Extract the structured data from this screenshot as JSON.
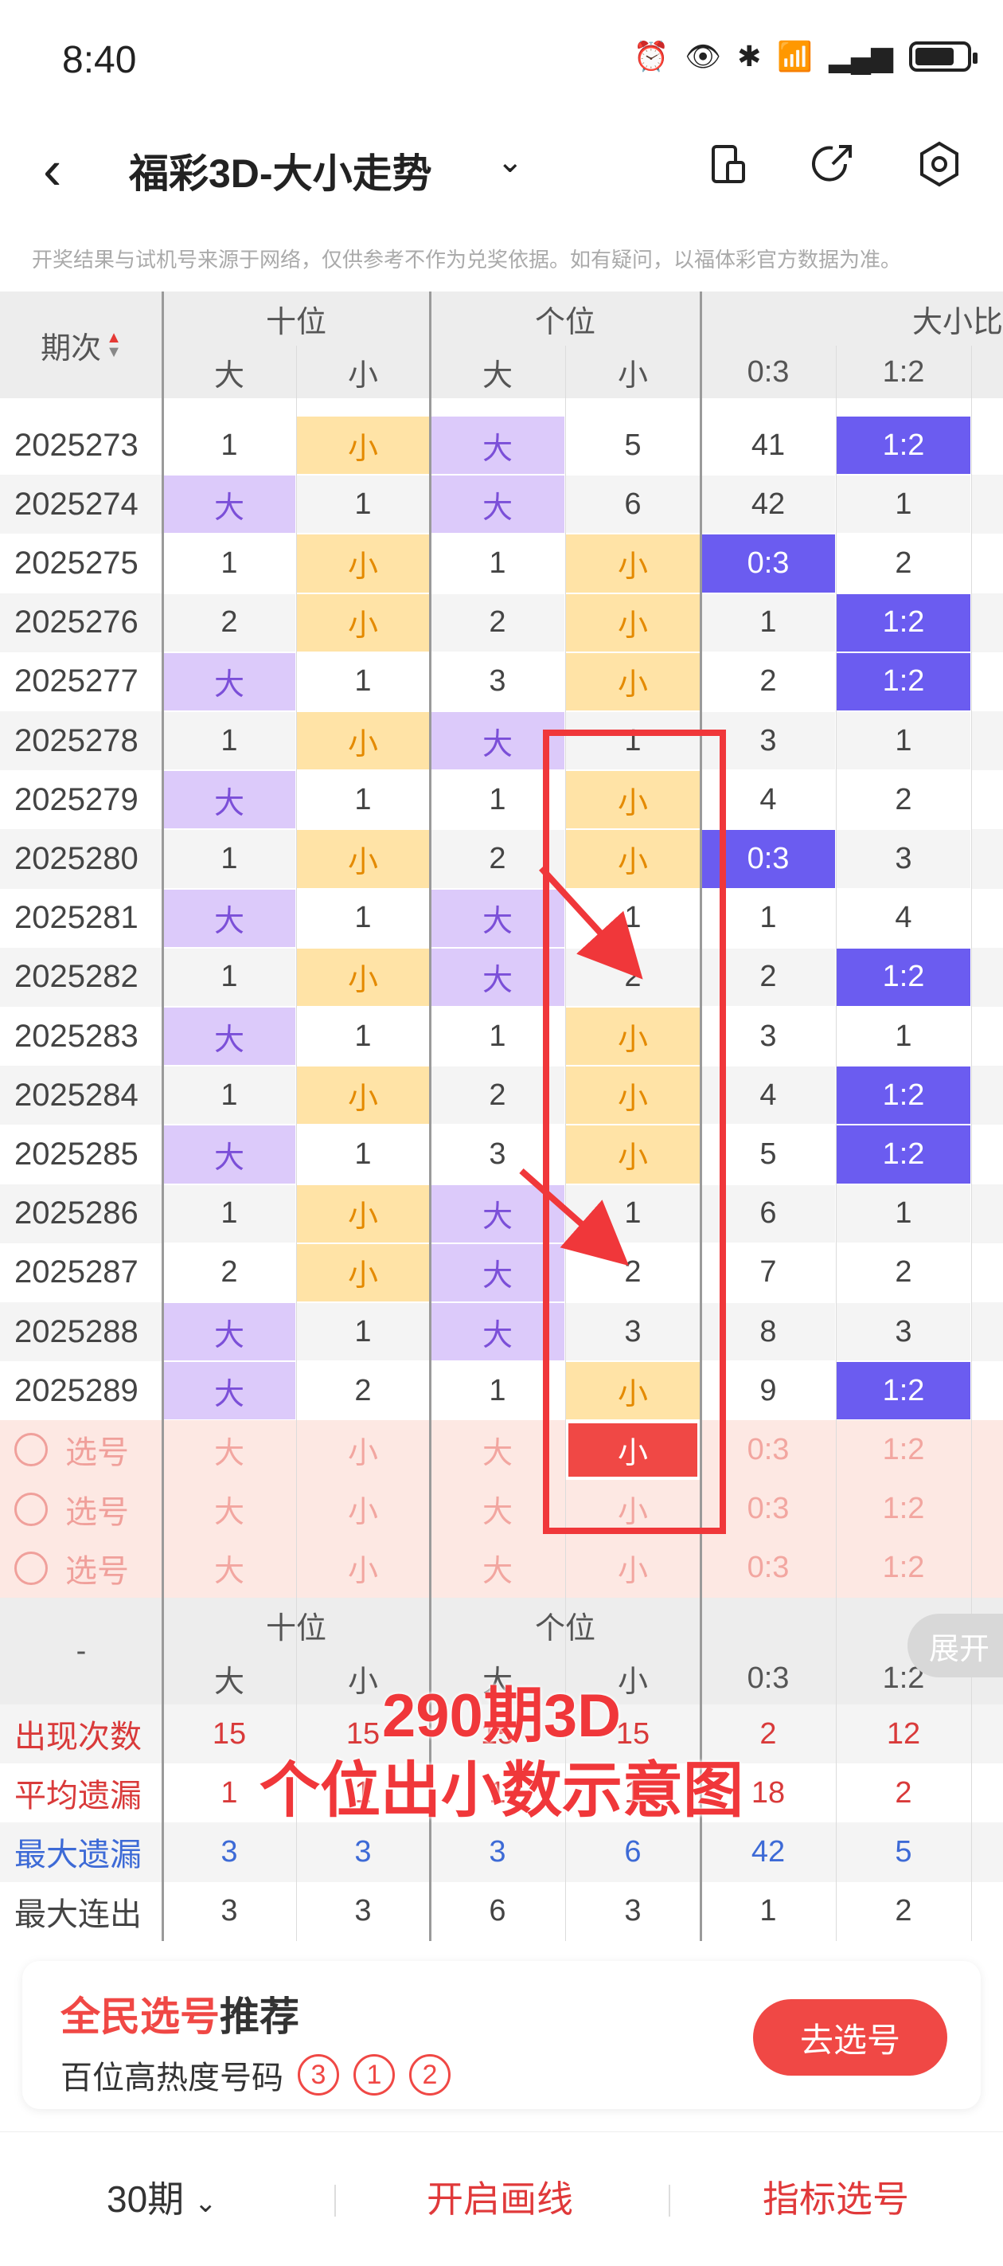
{
  "status_bar": {
    "time": "8:40"
  },
  "header": {
    "title": "福彩3D-大小走势"
  },
  "disclaimer": "开奖结果与试机号来源于网络，仅供参考不作为兑奖依据。如有疑问，以福体彩官方数据为准。",
  "table": {
    "period_header": "期次",
    "groups": [
      "十位",
      "个位",
      "大小比"
    ],
    "subheaders": [
      "大",
      "小",
      "大",
      "小",
      "0:3",
      "1:2"
    ],
    "rows": [
      {
        "p": "2025273",
        "c": [
          [
            "1",
            ""
          ],
          [
            "小",
            "s"
          ],
          [
            "大",
            "b"
          ],
          [
            "5",
            ""
          ],
          [
            "41",
            ""
          ],
          [
            "1:2",
            "r"
          ]
        ]
      },
      {
        "p": "2025274",
        "c": [
          [
            "大",
            "b"
          ],
          [
            "1",
            ""
          ],
          [
            "大",
            "b"
          ],
          [
            "6",
            ""
          ],
          [
            "42",
            ""
          ],
          [
            "1",
            ""
          ]
        ]
      },
      {
        "p": "2025275",
        "c": [
          [
            "1",
            ""
          ],
          [
            "小",
            "s"
          ],
          [
            "1",
            ""
          ],
          [
            "小",
            "s"
          ],
          [
            "0:3",
            "r"
          ],
          [
            "2",
            ""
          ]
        ]
      },
      {
        "p": "2025276",
        "c": [
          [
            "2",
            ""
          ],
          [
            "小",
            "s"
          ],
          [
            "2",
            ""
          ],
          [
            "小",
            "s"
          ],
          [
            "1",
            ""
          ],
          [
            "1:2",
            "r"
          ]
        ]
      },
      {
        "p": "2025277",
        "c": [
          [
            "大",
            "b"
          ],
          [
            "1",
            ""
          ],
          [
            "3",
            ""
          ],
          [
            "小",
            "s"
          ],
          [
            "2",
            ""
          ],
          [
            "1:2",
            "r"
          ]
        ]
      },
      {
        "p": "2025278",
        "c": [
          [
            "1",
            ""
          ],
          [
            "小",
            "s"
          ],
          [
            "大",
            "b"
          ],
          [
            "1",
            ""
          ],
          [
            "3",
            ""
          ],
          [
            "1",
            ""
          ]
        ]
      },
      {
        "p": "2025279",
        "c": [
          [
            "大",
            "b"
          ],
          [
            "1",
            ""
          ],
          [
            "1",
            ""
          ],
          [
            "小",
            "s"
          ],
          [
            "4",
            ""
          ],
          [
            "2",
            ""
          ]
        ]
      },
      {
        "p": "2025280",
        "c": [
          [
            "1",
            ""
          ],
          [
            "小",
            "s"
          ],
          [
            "2",
            ""
          ],
          [
            "小",
            "s"
          ],
          [
            "0:3",
            "r"
          ],
          [
            "3",
            ""
          ]
        ]
      },
      {
        "p": "2025281",
        "c": [
          [
            "大",
            "b"
          ],
          [
            "1",
            ""
          ],
          [
            "大",
            "b"
          ],
          [
            "1",
            ""
          ],
          [
            "1",
            ""
          ],
          [
            "4",
            ""
          ]
        ]
      },
      {
        "p": "2025282",
        "c": [
          [
            "1",
            ""
          ],
          [
            "小",
            "s"
          ],
          [
            "大",
            "b"
          ],
          [
            "2",
            ""
          ],
          [
            "2",
            ""
          ],
          [
            "1:2",
            "r"
          ]
        ]
      },
      {
        "p": "2025283",
        "c": [
          [
            "大",
            "b"
          ],
          [
            "1",
            ""
          ],
          [
            "1",
            ""
          ],
          [
            "小",
            "s"
          ],
          [
            "3",
            ""
          ],
          [
            "1",
            ""
          ]
        ]
      },
      {
        "p": "2025284",
        "c": [
          [
            "1",
            ""
          ],
          [
            "小",
            "s"
          ],
          [
            "2",
            ""
          ],
          [
            "小",
            "s"
          ],
          [
            "4",
            ""
          ],
          [
            "1:2",
            "r"
          ]
        ]
      },
      {
        "p": "2025285",
        "c": [
          [
            "大",
            "b"
          ],
          [
            "1",
            ""
          ],
          [
            "3",
            ""
          ],
          [
            "小",
            "s"
          ],
          [
            "5",
            ""
          ],
          [
            "1:2",
            "r"
          ]
        ]
      },
      {
        "p": "2025286",
        "c": [
          [
            "1",
            ""
          ],
          [
            "小",
            "s"
          ],
          [
            "大",
            "b"
          ],
          [
            "1",
            ""
          ],
          [
            "6",
            ""
          ],
          [
            "1",
            ""
          ]
        ]
      },
      {
        "p": "2025287",
        "c": [
          [
            "2",
            ""
          ],
          [
            "小",
            "s"
          ],
          [
            "大",
            "b"
          ],
          [
            "2",
            ""
          ],
          [
            "7",
            ""
          ],
          [
            "2",
            ""
          ]
        ]
      },
      {
        "p": "2025288",
        "c": [
          [
            "大",
            "b"
          ],
          [
            "1",
            ""
          ],
          [
            "大",
            "b"
          ],
          [
            "3",
            ""
          ],
          [
            "8",
            ""
          ],
          [
            "3",
            ""
          ]
        ]
      },
      {
        "p": "2025289",
        "c": [
          [
            "大",
            "b"
          ],
          [
            "2",
            ""
          ],
          [
            "1",
            ""
          ],
          [
            "小",
            "s"
          ],
          [
            "9",
            ""
          ],
          [
            "1:2",
            "r"
          ]
        ]
      }
    ],
    "select_rows": [
      {
        "label": "选号",
        "c": [
          "大",
          "小",
          "大",
          "小",
          "0:3",
          "1:2"
        ],
        "selected_col": 3
      },
      {
        "label": "选号",
        "c": [
          "大",
          "小",
          "大",
          "小",
          "0:3",
          "1:2"
        ],
        "selected_col": -1
      },
      {
        "label": "选号",
        "c": [
          "大",
          "小",
          "大",
          "小",
          "0:3",
          "1:2"
        ],
        "selected_col": -1
      }
    ],
    "stats_header_dash": "-",
    "stats": [
      {
        "label": "出现次数",
        "color": "#d93a3a",
        "c": [
          "15",
          "15",
          "15",
          "15",
          "2",
          "12"
        ]
      },
      {
        "label": "平均遗漏",
        "color": "#d93a3a",
        "c": [
          "1",
          "1",
          "1",
          "1",
          "18",
          "2"
        ]
      },
      {
        "label": "最大遗漏",
        "color": "#3d6ad6",
        "c": [
          "3",
          "3",
          "3",
          "6",
          "42",
          "5"
        ]
      },
      {
        "label": "最大连出",
        "color": "#444444",
        "c": [
          "3",
          "3",
          "6",
          "3",
          "1",
          "2"
        ]
      }
    ],
    "expand_label": "展开"
  },
  "overlay": {
    "line1": "290期3D",
    "line2": "个位出小数示意图"
  },
  "recommend": {
    "title_red": "全民选号",
    "title_black": "推荐",
    "subtitle": "百位高热度号码",
    "balls": [
      "3",
      "1",
      "2"
    ],
    "button": "去选号"
  },
  "bottom_bar": {
    "periods": "30期",
    "draw_lines": "开启画线",
    "indicator_select": "指标选号"
  },
  "colors": {
    "big_bg": "#dccafa",
    "small_bg": "#ffe3a6",
    "ratio_bg": "#6b5cf0",
    "accent": "#f04845"
  }
}
